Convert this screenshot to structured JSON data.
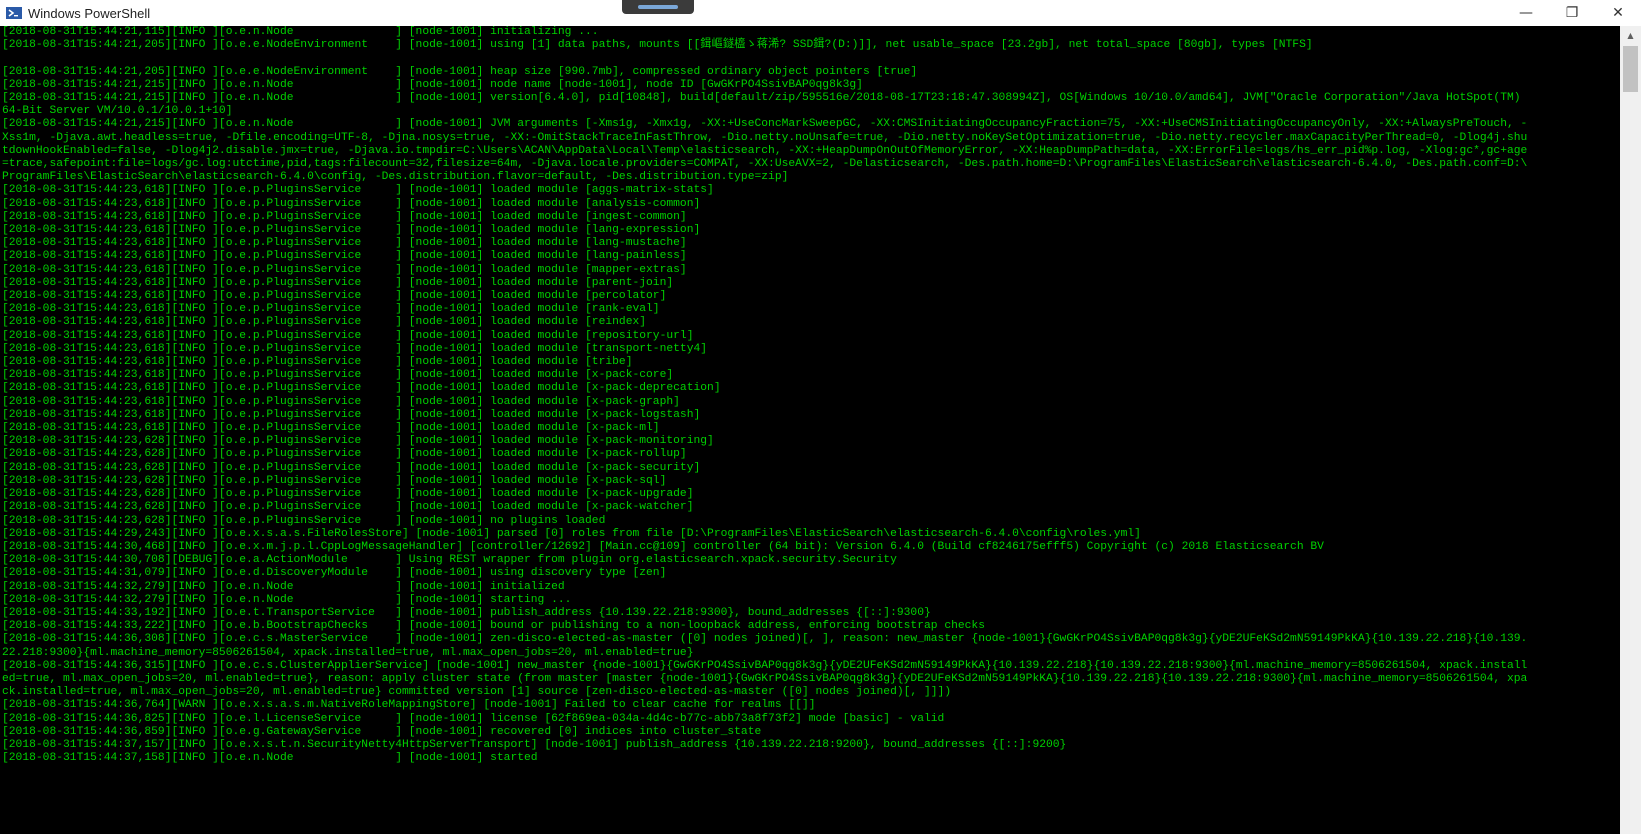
{
  "window": {
    "title": "Windows PowerShell"
  },
  "controls": {
    "minimize": "—",
    "restore": "❐",
    "close": "✕"
  },
  "scrollbar": {
    "up": "▲",
    "down": "▼"
  },
  "log_lines": [
    "[2018-08-31T15:44:21,115][INFO ][o.e.n.Node               ] [node-1001] initializing ...",
    "[2018-08-31T15:44:21,205][INFO ][o.e.e.NodeEnvironment    ] [node-1001] using [1] data paths, mounts [[鍓嶇鐩橀ゝ蒋浠? SSD鍓?(D:)]], net usable_space [23.2gb], net total_space [80gb], types [NTFS]",
    "",
    "[2018-08-31T15:44:21,205][INFO ][o.e.e.NodeEnvironment    ] [node-1001] heap size [990.7mb], compressed ordinary object pointers [true]",
    "[2018-08-31T15:44:21,215][INFO ][o.e.n.Node               ] [node-1001] node name [node-1001], node ID [GwGKrPO4SsivBAP0qg8k3g]",
    "[2018-08-31T15:44:21,215][INFO ][o.e.n.Node               ] [node-1001] version[6.4.0], pid[10848], build[default/zip/595516e/2018-08-17T23:18:47.308994Z], OS[Windows 10/10.0/amd64], JVM[\"Oracle Corporation\"/Java HotSpot(TM)",
    "64-Bit Server VM/10.0.1/10.0.1+10]",
    "[2018-08-31T15:44:21,215][INFO ][o.e.n.Node               ] [node-1001] JVM arguments [-Xms1g, -Xmx1g, -XX:+UseConcMarkSweepGC, -XX:CMSInitiatingOccupancyFraction=75, -XX:+UseCMSInitiatingOccupancyOnly, -XX:+AlwaysPreTouch, -",
    "Xss1m, -Djava.awt.headless=true, -Dfile.encoding=UTF-8, -Djna.nosys=true, -XX:-OmitStackTraceInFastThrow, -Dio.netty.noUnsafe=true, -Dio.netty.noKeySetOptimization=true, -Dio.netty.recycler.maxCapacityPerThread=0, -Dlog4j.shu",
    "tdownHookEnabled=false, -Dlog4j2.disable.jmx=true, -Djava.io.tmpdir=C:\\Users\\ACAN\\AppData\\Local\\Temp\\elasticsearch, -XX:+HeapDumpOnOutOfMemoryError, -XX:HeapDumpPath=data, -XX:ErrorFile=logs/hs_err_pid%p.log, -Xlog:gc*,gc+age",
    "=trace,safepoint:file=logs/gc.log:utctime,pid,tags:filecount=32,filesize=64m, -Djava.locale.providers=COMPAT, -XX:UseAVX=2, -Delasticsearch, -Des.path.home=D:\\ProgramFiles\\ElasticSearch\\elasticsearch-6.4.0, -Des.path.conf=D:\\",
    "ProgramFiles\\ElasticSearch\\elasticsearch-6.4.0\\config, -Des.distribution.flavor=default, -Des.distribution.type=zip]",
    "[2018-08-31T15:44:23,618][INFO ][o.e.p.PluginsService     ] [node-1001] loaded module [aggs-matrix-stats]",
    "[2018-08-31T15:44:23,618][INFO ][o.e.p.PluginsService     ] [node-1001] loaded module [analysis-common]",
    "[2018-08-31T15:44:23,618][INFO ][o.e.p.PluginsService     ] [node-1001] loaded module [ingest-common]",
    "[2018-08-31T15:44:23,618][INFO ][o.e.p.PluginsService     ] [node-1001] loaded module [lang-expression]",
    "[2018-08-31T15:44:23,618][INFO ][o.e.p.PluginsService     ] [node-1001] loaded module [lang-mustache]",
    "[2018-08-31T15:44:23,618][INFO ][o.e.p.PluginsService     ] [node-1001] loaded module [lang-painless]",
    "[2018-08-31T15:44:23,618][INFO ][o.e.p.PluginsService     ] [node-1001] loaded module [mapper-extras]",
    "[2018-08-31T15:44:23,618][INFO ][o.e.p.PluginsService     ] [node-1001] loaded module [parent-join]",
    "[2018-08-31T15:44:23,618][INFO ][o.e.p.PluginsService     ] [node-1001] loaded module [percolator]",
    "[2018-08-31T15:44:23,618][INFO ][o.e.p.PluginsService     ] [node-1001] loaded module [rank-eval]",
    "[2018-08-31T15:44:23,618][INFO ][o.e.p.PluginsService     ] [node-1001] loaded module [reindex]",
    "[2018-08-31T15:44:23,618][INFO ][o.e.p.PluginsService     ] [node-1001] loaded module [repository-url]",
    "[2018-08-31T15:44:23,618][INFO ][o.e.p.PluginsService     ] [node-1001] loaded module [transport-netty4]",
    "[2018-08-31T15:44:23,618][INFO ][o.e.p.PluginsService     ] [node-1001] loaded module [tribe]",
    "[2018-08-31T15:44:23,618][INFO ][o.e.p.PluginsService     ] [node-1001] loaded module [x-pack-core]",
    "[2018-08-31T15:44:23,618][INFO ][o.e.p.PluginsService     ] [node-1001] loaded module [x-pack-deprecation]",
    "[2018-08-31T15:44:23,618][INFO ][o.e.p.PluginsService     ] [node-1001] loaded module [x-pack-graph]",
    "[2018-08-31T15:44:23,618][INFO ][o.e.p.PluginsService     ] [node-1001] loaded module [x-pack-logstash]",
    "[2018-08-31T15:44:23,618][INFO ][o.e.p.PluginsService     ] [node-1001] loaded module [x-pack-ml]",
    "[2018-08-31T15:44:23,628][INFO ][o.e.p.PluginsService     ] [node-1001] loaded module [x-pack-monitoring]",
    "[2018-08-31T15:44:23,628][INFO ][o.e.p.PluginsService     ] [node-1001] loaded module [x-pack-rollup]",
    "[2018-08-31T15:44:23,628][INFO ][o.e.p.PluginsService     ] [node-1001] loaded module [x-pack-security]",
    "[2018-08-31T15:44:23,628][INFO ][o.e.p.PluginsService     ] [node-1001] loaded module [x-pack-sql]",
    "[2018-08-31T15:44:23,628][INFO ][o.e.p.PluginsService     ] [node-1001] loaded module [x-pack-upgrade]",
    "[2018-08-31T15:44:23,628][INFO ][o.e.p.PluginsService     ] [node-1001] loaded module [x-pack-watcher]",
    "[2018-08-31T15:44:23,628][INFO ][o.e.p.PluginsService     ] [node-1001] no plugins loaded",
    "[2018-08-31T15:44:29,243][INFO ][o.e.x.s.a.s.FileRolesStore] [node-1001] parsed [0] roles from file [D:\\ProgramFiles\\ElasticSearch\\elasticsearch-6.4.0\\config\\roles.yml]",
    "[2018-08-31T15:44:30,468][INFO ][o.e.x.m.j.p.l.CppLogMessageHandler] [controller/12692] [Main.cc@109] controller (64 bit): Version 6.4.0 (Build cf8246175efff5) Copyright (c) 2018 Elasticsearch BV",
    "[2018-08-31T15:44:30,708][DEBUG][o.e.a.ActionModule       ] Using REST wrapper from plugin org.elasticsearch.xpack.security.Security",
    "[2018-08-31T15:44:31,079][INFO ][o.e.d.DiscoveryModule    ] [node-1001] using discovery type [zen]",
    "[2018-08-31T15:44:32,279][INFO ][o.e.n.Node               ] [node-1001] initialized",
    "[2018-08-31T15:44:32,279][INFO ][o.e.n.Node               ] [node-1001] starting ...",
    "[2018-08-31T15:44:33,192][INFO ][o.e.t.TransportService   ] [node-1001] publish_address {10.139.22.218:9300}, bound_addresses {[::]:9300}",
    "[2018-08-31T15:44:33,222][INFO ][o.e.b.BootstrapChecks    ] [node-1001] bound or publishing to a non-loopback address, enforcing bootstrap checks",
    "[2018-08-31T15:44:36,308][INFO ][o.e.c.s.MasterService    ] [node-1001] zen-disco-elected-as-master ([0] nodes joined)[, ], reason: new_master {node-1001}{GwGKrPO4SsivBAP0qg8k3g}{yDE2UFeKSd2mN59149PkKA}{10.139.22.218}{10.139.",
    "22.218:9300}{ml.machine_memory=8506261504, xpack.installed=true, ml.max_open_jobs=20, ml.enabled=true}",
    "[2018-08-31T15:44:36,315][INFO ][o.e.c.s.ClusterApplierService] [node-1001] new_master {node-1001}{GwGKrPO4SsivBAP0qg8k3g}{yDE2UFeKSd2mN59149PkKA}{10.139.22.218}{10.139.22.218:9300}{ml.machine_memory=8506261504, xpack.install",
    "ed=true, ml.max_open_jobs=20, ml.enabled=true}, reason: apply cluster state (from master [master {node-1001}{GwGKrPO4SsivBAP0qg8k3g}{yDE2UFeKSd2mN59149PkKA}{10.139.22.218}{10.139.22.218:9300}{ml.machine_memory=8506261504, xpa",
    "ck.installed=true, ml.max_open_jobs=20, ml.enabled=true} committed version [1] source [zen-disco-elected-as-master ([0] nodes joined)[, ]]])",
    "[2018-08-31T15:44:36,764][WARN ][o.e.x.s.a.s.m.NativeRoleMappingStore] [node-1001] Failed to clear cache for realms [[]]",
    "[2018-08-31T15:44:36,825][INFO ][o.e.l.LicenseService     ] [node-1001] license [62f869ea-034a-4d4c-b77c-abb73a8f73f2] mode [basic] - valid",
    "[2018-08-31T15:44:36,859][INFO ][o.e.g.GatewayService     ] [node-1001] recovered [0] indices into cluster_state",
    "[2018-08-31T15:44:37,157][INFO ][o.e.x.s.t.n.SecurityNetty4HttpServerTransport] [node-1001] publish_address {10.139.22.218:9200}, bound_addresses {[::]:9200}",
    "[2018-08-31T15:44:37,158][INFO ][o.e.n.Node               ] [node-1001] started"
  ]
}
